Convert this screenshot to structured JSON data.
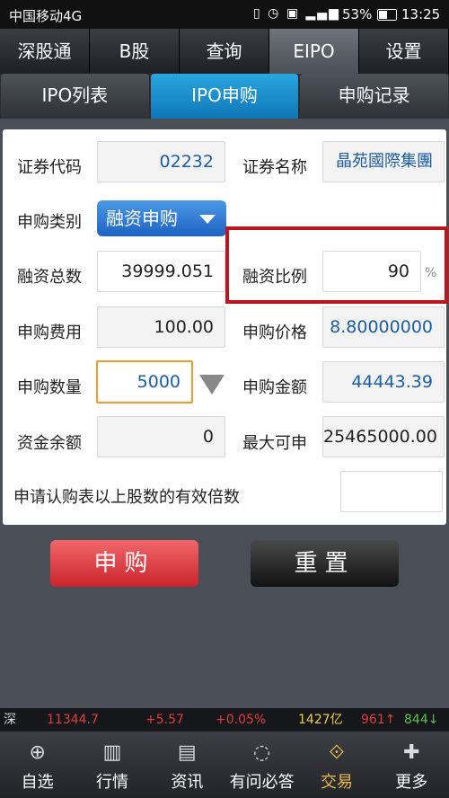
{
  "status": {
    "carrier": "中国移动4G",
    "battery": "53%",
    "time": "13:25",
    "icons": [
      "vibrate-icon",
      "alarm-icon",
      "hd-icon",
      "signal-icon"
    ]
  },
  "top_tabs": [
    "深股通",
    "B股",
    "查询",
    "EIPO",
    "设置"
  ],
  "sub_tabs": [
    "IPO列表",
    "IPO申购",
    "申购记录"
  ],
  "form": {
    "stock_code_label": "证券代码",
    "stock_code_value": "02232",
    "stock_name_label": "证券名称",
    "stock_name_value": "晶苑國際集團",
    "sub_type_label": "申购类别",
    "sub_type_value": "融资申购",
    "finance_total_label": "融资总数",
    "finance_total_value": "39999.051",
    "finance_ratio_label": "融资比例",
    "finance_ratio_value": "90",
    "finance_ratio_unit": "%",
    "fee_label": "申购费用",
    "fee_value": "100.00",
    "price_label": "申购价格",
    "price_value": "8.80000000",
    "qty_label": "申购数量",
    "qty_value": "5000",
    "amount_label": "申购金额",
    "amount_value": "44443.39",
    "balance_label": "资金余额",
    "balance_value": "0",
    "max_label": "最大可申",
    "max_value": "25465000.00",
    "multiple_label": "申请认购表以上股数的有效倍数",
    "multiple_value": ""
  },
  "buttons": {
    "submit": "申购",
    "reset": "重置"
  },
  "ticker": {
    "market": "深",
    "index": "11344.7",
    "change": "+5.57",
    "change_pct": "+0.05%",
    "volume": "1427亿",
    "up": "961↑",
    "down": "844↓"
  },
  "colors": {
    "up": "#e23b3b",
    "down": "#5bbf4a",
    "accent": "#1d7fcc"
  },
  "bottom_nav": [
    {
      "label": "自选",
      "icon": "add-doc-icon"
    },
    {
      "label": "行情",
      "icon": "chart-icon"
    },
    {
      "label": "资讯",
      "icon": "news-icon"
    },
    {
      "label": "有问必答",
      "icon": "chat-icon"
    },
    {
      "label": "交易",
      "icon": "handshake-icon"
    },
    {
      "label": "更多",
      "icon": "shield-plus-icon"
    }
  ]
}
